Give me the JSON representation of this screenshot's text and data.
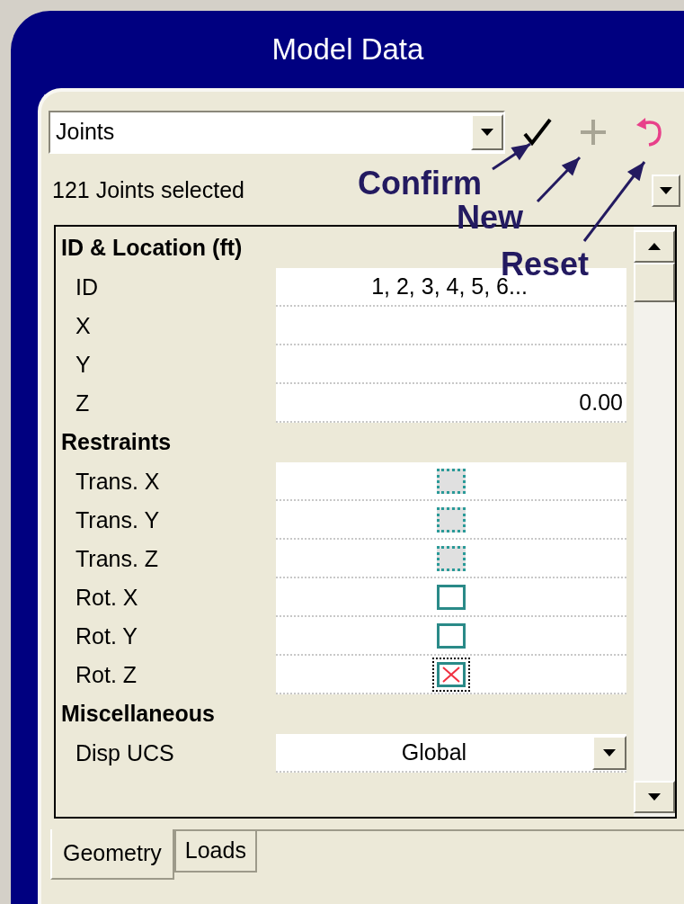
{
  "window": {
    "title": "Model Data"
  },
  "object_type": {
    "value": "Joints"
  },
  "toolbar": [
    {
      "kind": "confirm",
      "disabled": false
    },
    {
      "kind": "new",
      "disabled": true
    },
    {
      "kind": "reset",
      "disabled": false
    }
  ],
  "selection_status": "121 Joints selected",
  "annotations": [
    {
      "label": "Confirm"
    },
    {
      "label": "New"
    },
    {
      "label": "Reset"
    }
  ],
  "sections": [
    {
      "title": "ID & Location (ft)",
      "rows": [
        {
          "kind": "list",
          "label": "ID",
          "value": "1, 2, 3, 4, 5, 6..."
        },
        {
          "kind": "number",
          "label": "X"
        },
        {
          "kind": "number",
          "label": "Y"
        },
        {
          "kind": "number",
          "label": "Z",
          "value": "0.00"
        }
      ]
    },
    {
      "title": "Restraints",
      "rows": [
        {
          "kind": "checkbox",
          "label": "Trans. X",
          "checked": false,
          "mixed": true,
          "focused": false
        },
        {
          "kind": "checkbox",
          "label": "Trans. Y",
          "checked": false,
          "mixed": true,
          "focused": false
        },
        {
          "kind": "checkbox",
          "label": "Trans. Z",
          "checked": false,
          "mixed": true,
          "focused": false
        },
        {
          "kind": "checkbox",
          "label": "Rot. X",
          "checked": false,
          "mixed": false,
          "focused": false
        },
        {
          "kind": "checkbox",
          "label": "Rot. Y",
          "checked": false,
          "mixed": false,
          "focused": false
        },
        {
          "kind": "checkbox",
          "label": "Rot. Z",
          "checked": true,
          "mixed": false,
          "focused": true
        }
      ]
    },
    {
      "title": "Miscellaneous",
      "rows": [
        {
          "kind": "dropdown",
          "label": "Disp UCS",
          "value": "Global"
        }
      ]
    }
  ],
  "tabs": [
    {
      "label": "Geometry",
      "selected": true
    },
    {
      "label": "Loads",
      "selected": false
    }
  ]
}
